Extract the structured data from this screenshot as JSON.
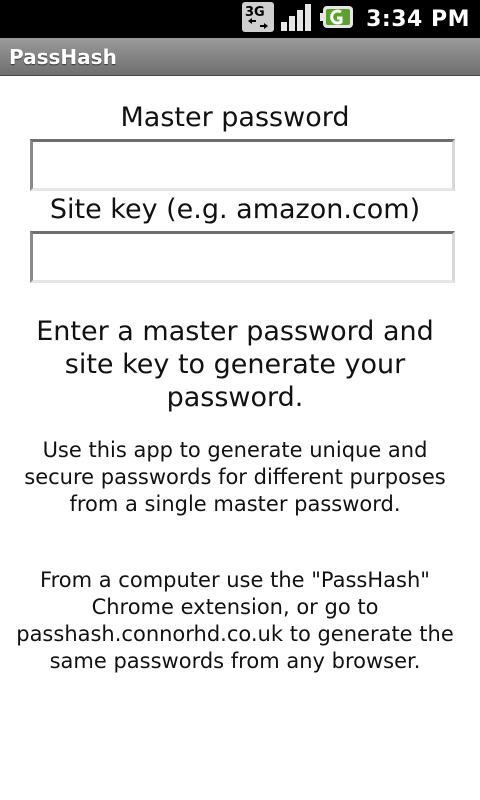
{
  "status_bar": {
    "network_icon": "3g-icon",
    "signal_icon": "signal-strength-icon",
    "battery_icon": "battery-charging-icon",
    "time": "3:34 PM"
  },
  "app": {
    "title": "PassHash"
  },
  "form": {
    "master_password_label": "Master password",
    "master_password_value": "",
    "site_key_label": "Site key (e.g. amazon.com)",
    "site_key_value": ""
  },
  "messages": {
    "status": "Enter a master password and site key to generate your password.",
    "description": "Use this app to generate unique and secure passwords for different purposes from a single master password.",
    "extension_info": "From a computer use the \"PassHash\" Chrome extension, or go to passhash.connorhd.co.uk to generate the same passwords from any browser."
  },
  "colors": {
    "status_bar_bg": "#000000",
    "title_bar_bg": "#808080",
    "background": "#ffffff",
    "text": "#111111"
  }
}
